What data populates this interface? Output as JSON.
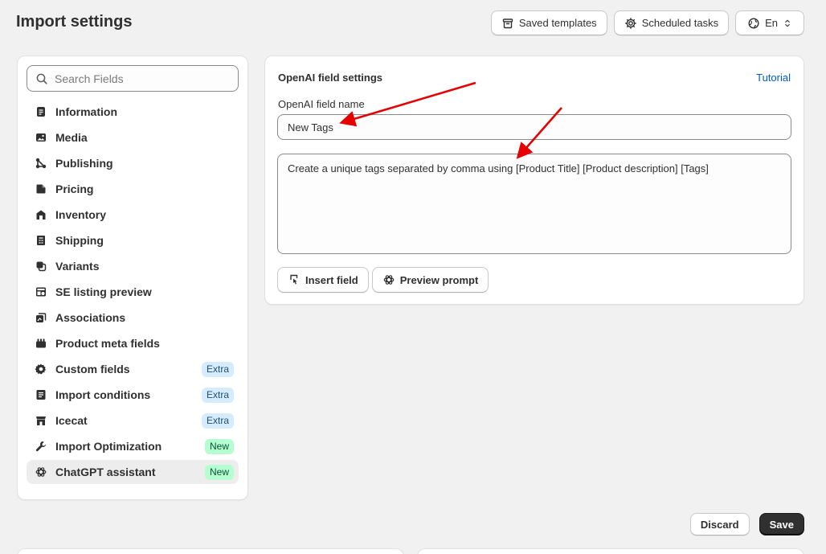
{
  "header": {
    "title": "Import settings",
    "saved_templates_label": "Saved templates",
    "scheduled_tasks_label": "Scheduled tasks",
    "language_label": "En"
  },
  "sidebar": {
    "search_placeholder": "Search Fields",
    "items": [
      {
        "label": "Information",
        "icon": "document-icon",
        "badge": ""
      },
      {
        "label": "Media",
        "icon": "image-icon",
        "badge": ""
      },
      {
        "label": "Publishing",
        "icon": "publishing-icon",
        "badge": ""
      },
      {
        "label": "Pricing",
        "icon": "price-tag-icon",
        "badge": ""
      },
      {
        "label": "Inventory",
        "icon": "inventory-icon",
        "badge": ""
      },
      {
        "label": "Shipping",
        "icon": "shipping-icon",
        "badge": ""
      },
      {
        "label": "Variants",
        "icon": "variants-icon",
        "badge": ""
      },
      {
        "label": "SE listing preview",
        "icon": "listing-preview-icon",
        "badge": ""
      },
      {
        "label": "Associations",
        "icon": "associations-icon",
        "badge": ""
      },
      {
        "label": "Product meta fields",
        "icon": "meta-fields-icon",
        "badge": ""
      },
      {
        "label": "Custom fields",
        "icon": "gear-icon",
        "badge": "Extra"
      },
      {
        "label": "Import conditions",
        "icon": "conditions-icon",
        "badge": "Extra"
      },
      {
        "label": "Icecat",
        "icon": "store-icon",
        "badge": "Extra"
      },
      {
        "label": "Import Optimization",
        "icon": "wrench-icon",
        "badge": "New"
      },
      {
        "label": "ChatGPT assistant",
        "icon": "openai-icon",
        "badge": "New"
      }
    ],
    "active_item": "ChatGPT assistant"
  },
  "settings": {
    "title": "OpenAI field settings",
    "tutorial_label": "Tutorial",
    "field_name_label": "OpenAI field name",
    "field_name_value": "New Tags",
    "prompt_value": "Create a unique tags separated by comma using [Product Title] [Product description] [Tags]",
    "insert_field_label": "Insert field",
    "preview_prompt_label": "Preview prompt"
  },
  "footer": {
    "discard_label": "Discard",
    "save_label": "Save"
  },
  "colors": {
    "accent_link": "#005bd3",
    "save_button": "#303030",
    "badge_extra_bg": "#d6ebfd",
    "badge_new_bg": "#b4fed2",
    "annotation_arrow": "#e60000"
  }
}
